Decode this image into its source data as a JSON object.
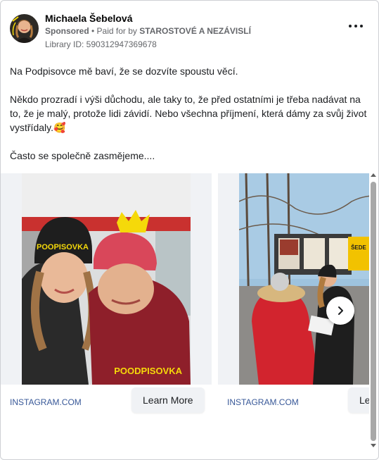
{
  "post": {
    "author_name": "Michaela Šebelová",
    "sponsored_label": "Sponsored",
    "paid_for_prefix": " • Paid for by ",
    "paid_for_by": "STAROSTOVÉ A NEZÁVISLÍ",
    "library_id": "Library ID: 590312947369678",
    "more_icon": "more-horizontal-icon",
    "body_paragraphs": [
      "Na Podpisovce mě baví, že se dozvíte spoustu věcí.",
      "Někdo prozradí i výši důchodu, ale taky to, že před ostatními je třeba nadávat na to, že je malý, protože lidi závidí. Nebo všechna příjmení, která dámy za svůj život vystřídaly.🥰",
      "Často se společně zasmějeme...."
    ]
  },
  "carousel": {
    "cards": [
      {
        "image_caption": "POODPISOVKA",
        "hat_text": "POOPISOVKA",
        "domain": "INSTAGRAM.COM",
        "cta": "Learn More"
      },
      {
        "image_caption": "ŠEDE",
        "domain": "INSTAGRAM.COM",
        "cta": "Learn More"
      }
    ],
    "next_icon": "chevron-right-icon"
  },
  "colors": {
    "link_blue": "#385898",
    "muted_text": "#65676b",
    "button_bg": "#f0f2f5",
    "accent_yellow": "#f5d90a"
  }
}
